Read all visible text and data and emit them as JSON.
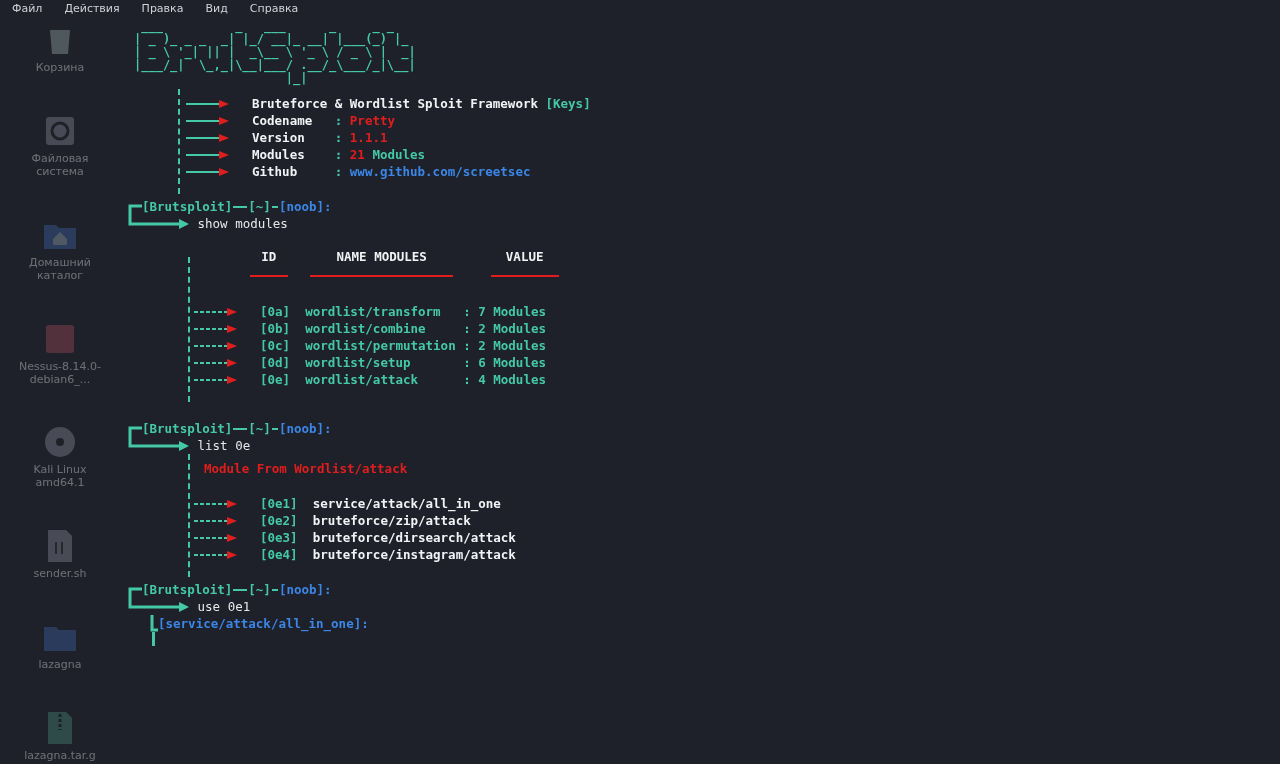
{
  "menu": [
    "Файл",
    "Действия",
    "Правка",
    "Вид",
    "Справка"
  ],
  "desktop_icons": [
    {
      "kind": "trash",
      "label": "Корзина"
    },
    {
      "kind": "drive",
      "label": "Файловая система"
    },
    {
      "kind": "home",
      "label": "Домашний каталог"
    },
    {
      "kind": "package",
      "label": "Nessus-8.14.0-debian6_..."
    },
    {
      "kind": "disc",
      "label": "Kali Linux amd64.1"
    },
    {
      "kind": "script",
      "label": "sender.sh"
    },
    {
      "kind": "folder",
      "label": "lazagna"
    },
    {
      "kind": "archive",
      "label": "lazagna.tar.g"
    }
  ],
  "banner": {
    "art": [
      " ___          _   ___      _     _ _   ",
      "| _ )_ _ _  _| |_/ __|_ __| |___(_) |_ ",
      "| _ \\ '_| || |  _\\__ \\ '_ \\ / _ \\ |  _|",
      "|___/_|  \\_,_|\\__|___/ .__/_\\___/_|\\__|",
      "                     |_|               "
    ],
    "info": [
      {
        "kind": "title",
        "label": "Bruteforce & Wordlist Sploit Framework",
        "value": "[Keys]"
      },
      {
        "kind": "field",
        "label": "Codename",
        "sep": ":",
        "value": "Pretty"
      },
      {
        "kind": "field",
        "label": "Version",
        "sep": ":",
        "value": "1.1.1"
      },
      {
        "kind": "field",
        "label": "Modules",
        "sep": ":",
        "value": "21",
        "suffix": "Modules"
      },
      {
        "kind": "link",
        "label": "Github",
        "sep": ":",
        "value": "www.github.com/screetsec"
      }
    ]
  },
  "blocks": [
    {
      "kind": "prompt",
      "name": "[Brutsploit]",
      "path": "[~]",
      "user": "[noob]:",
      "command": "show modules"
    },
    {
      "kind": "module_table",
      "columns": [
        "ID",
        "NAME MODULES",
        "VALUE"
      ],
      "rows": [
        {
          "id": "[0a]",
          "name": "wordlist/transform",
          "value": ": 7 Modules"
        },
        {
          "id": "[0b]",
          "name": "wordlist/combine",
          "value": ": 2 Modules"
        },
        {
          "id": "[0c]",
          "name": "wordlist/permutation",
          "value": ": 2 Modules"
        },
        {
          "id": "[0d]",
          "name": "wordlist/setup",
          "value": ": 6 Modules"
        },
        {
          "id": "[0e]",
          "name": "wordlist/attack",
          "value": ": 4 Modules"
        }
      ]
    },
    {
      "kind": "prompt",
      "name": "[Brutsploit]",
      "path": "[~]",
      "user": "[noob]:",
      "command": "list 0e"
    },
    {
      "kind": "module_list",
      "title": "Module From Wordlist/attack",
      "rows": [
        {
          "id": "[0e1]",
          "name": "service/attack/all_in_one"
        },
        {
          "id": "[0e2]",
          "name": "bruteforce/zip/attack"
        },
        {
          "id": "[0e3]",
          "name": "bruteforce/dirsearch/attack"
        },
        {
          "id": "[0e4]",
          "name": "bruteforce/instagram/attack"
        }
      ]
    },
    {
      "kind": "prompt",
      "name": "[Brutsploit]",
      "path": "[~]",
      "user": "[noob]:",
      "command": "use 0e1"
    },
    {
      "kind": "context",
      "path": "[service/attack/all_in_one]:"
    }
  ]
}
